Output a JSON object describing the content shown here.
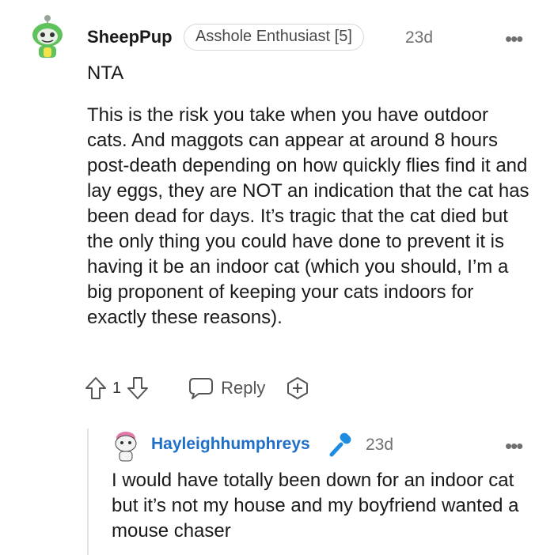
{
  "comment": {
    "username": "SheepPup",
    "flair": "Asshole Enthusiast [5]",
    "age": "23d",
    "more_menu": "•••",
    "body_short": "NTA",
    "body_main": "This is the risk you take when you have outdoor cats. And maggots can appear at around 8 hours post-death depending on how quickly flies find it and lay eggs, they are NOT an indication that the cat has been dead for days. It’s tragic that the cat died but the only thing you could have done to prevent it is having it be an indoor cat (which you should, I’m a big proponent of keeping your cats indoors for exactly these reasons).",
    "votes": "1",
    "reply_label": "Reply",
    "icons": {
      "avatar": "snoo-avatar",
      "upvote": "upvote-arrow-icon",
      "downvote": "downvote-arrow-icon",
      "reply": "speech-bubble-icon",
      "award": "award-plus-icon"
    }
  },
  "reply": {
    "username": "Hayleighhumphreys",
    "age": "23d",
    "more_menu": "•••",
    "body": "I would have totally been down for an indoor cat but it’s not my house and my boyfriend wanted a mouse chaser",
    "icons": {
      "avatar": "snoo-avatar",
      "badge": "microphone-icon"
    }
  },
  "colors": {
    "username_reply": "#1f6fc9",
    "mic_badge": "#1d8ce0",
    "muted_text": "#707070",
    "thread_line": "#e3e3e3"
  }
}
